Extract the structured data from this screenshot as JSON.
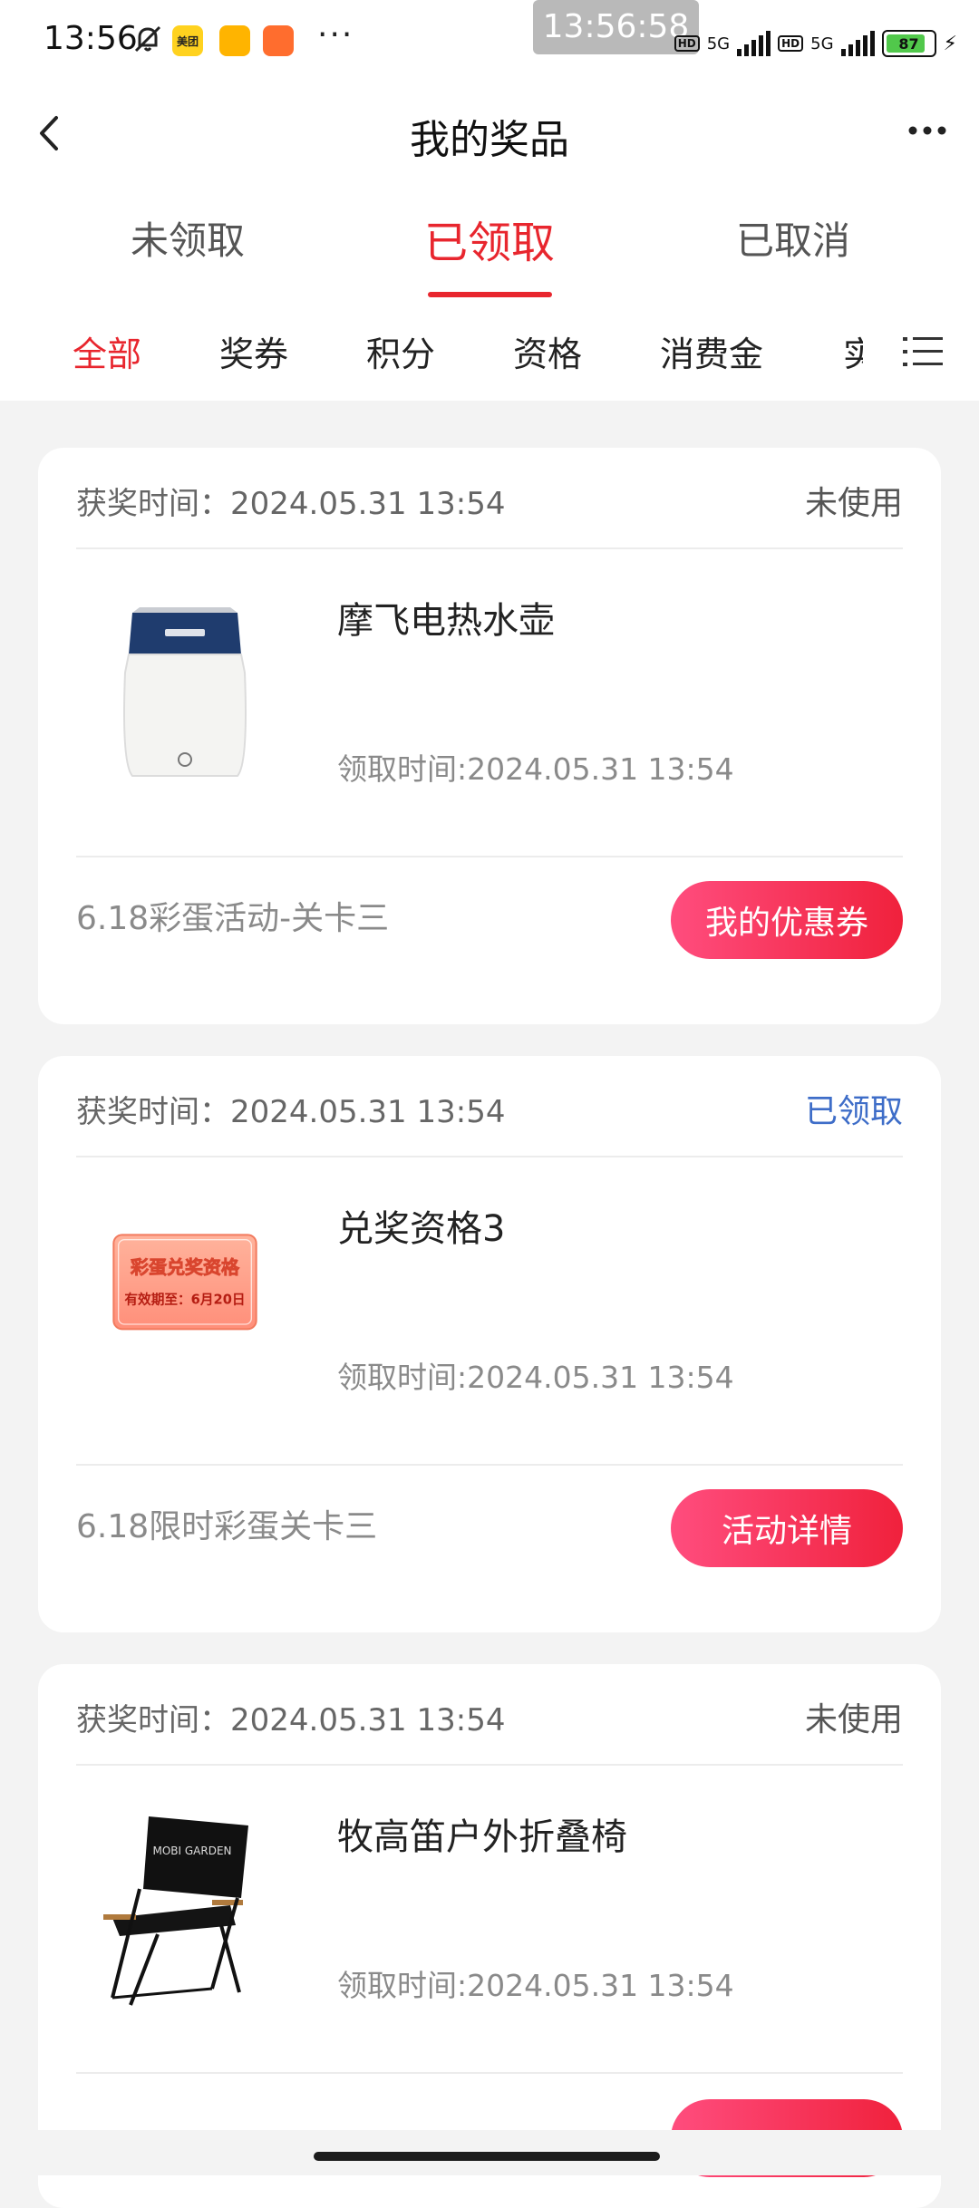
{
  "status_bar": {
    "time": "13:56",
    "overlay_time": "13:56:58",
    "app_meituan": "美团",
    "more": "···",
    "net1": "5G",
    "net2": "5G",
    "hd": "HD",
    "battery": "87"
  },
  "header": {
    "title": "我的奖品"
  },
  "main_tabs": [
    {
      "label": "未领取",
      "active": false
    },
    {
      "label": "已领取",
      "active": true
    },
    {
      "label": "已取消",
      "active": false
    }
  ],
  "category_tabs": [
    {
      "label": "全部",
      "active": true
    },
    {
      "label": "奖券",
      "active": false
    },
    {
      "label": "积分",
      "active": false
    },
    {
      "label": "资格",
      "active": false
    },
    {
      "label": "消费金",
      "active": false
    },
    {
      "label": "实",
      "active": false
    }
  ],
  "cards": [
    {
      "award_time": "获奖时间：2024.05.31 13:54",
      "status": "未使用",
      "prize_name": "摩飞电热水壶",
      "claim_time": "领取时间:2024.05.31 13:54",
      "activity": "6.18彩蛋活动-关卡三",
      "button": "我的优惠券",
      "thumb_icon": "electric-kettle"
    },
    {
      "award_time": "获奖时间：2024.05.31 13:54",
      "status": "已领取",
      "status_color": "#3e6dc8",
      "prize_name": "兑奖资格3",
      "claim_time": "领取时间:2024.05.31 13:54",
      "activity": "6.18限时彩蛋关卡三",
      "button": "活动详情",
      "thumb_icon": "qualification-ticket",
      "ticket_title": "彩蛋兑奖资格",
      "ticket_validity": "有效期至：6月20日"
    },
    {
      "award_time": "获奖时间：2024.05.31 13:54",
      "status": "未使用",
      "prize_name": "牧高笛户外折叠椅",
      "claim_time": "领取时间:2024.05.31 13:54",
      "thumb_icon": "folding-chair",
      "chair_brand": "MOBI GARDEN"
    }
  ],
  "colors": {
    "accent": "#e8262e",
    "claimed_blue": "#3e6dc8",
    "button_gradient_start": "#ff4d7e",
    "button_gradient_end": "#f0213c"
  }
}
